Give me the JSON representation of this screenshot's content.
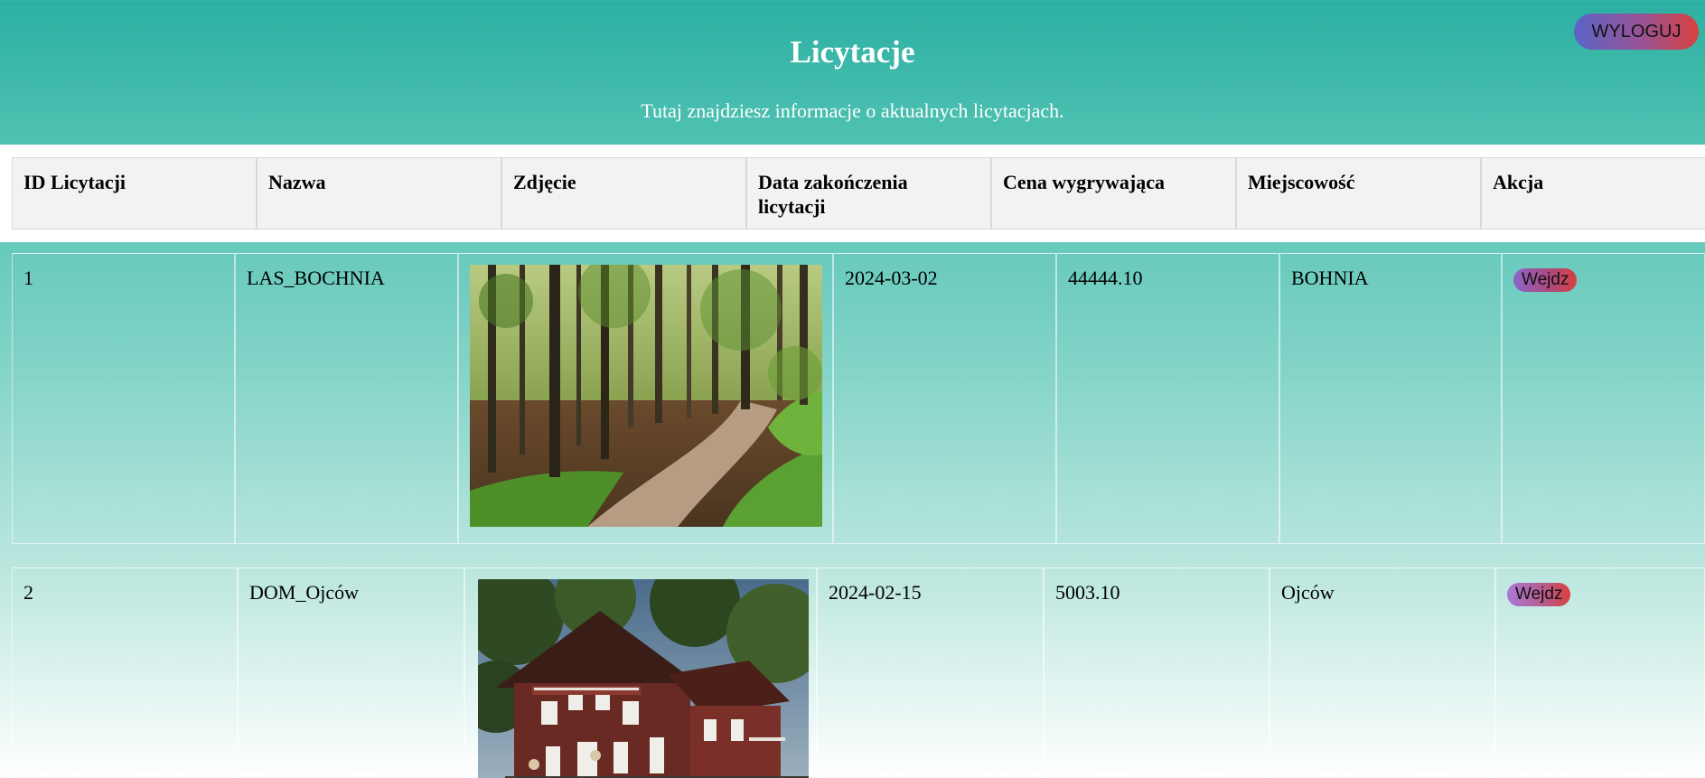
{
  "header": {
    "title": "Licytacje",
    "subtitle": "Tutaj znajdziesz informacje o aktualnych licytacjach.",
    "logout_label": "WYLOGUJ"
  },
  "table": {
    "columns": [
      "ID Licytacji",
      "Nazwa",
      "Zdjęcie",
      "Data zakończenia licytacji",
      "Cena wygrywająca",
      "Miejscowość",
      "Akcja"
    ],
    "rows": [
      {
        "id": "1",
        "name": "LAS_BOCHNIA",
        "photo": "forest-path-photo",
        "end_date": "2024-03-02",
        "price": "44444.10",
        "town": "BOHNIA",
        "action_label": "Wejdz"
      },
      {
        "id": "2",
        "name": "DOM_Ojców",
        "photo": "wooden-house-photo",
        "end_date": "2024-02-15",
        "price": "5003.10",
        "town": "Ojców",
        "action_label": "Wejdz"
      }
    ]
  },
  "colors": {
    "header_teal": "#2bb0a2",
    "logout_gradient_start": "#5a64c8",
    "logout_gradient_end": "#d8413e",
    "table_header_bg": "#f2f2f2"
  }
}
